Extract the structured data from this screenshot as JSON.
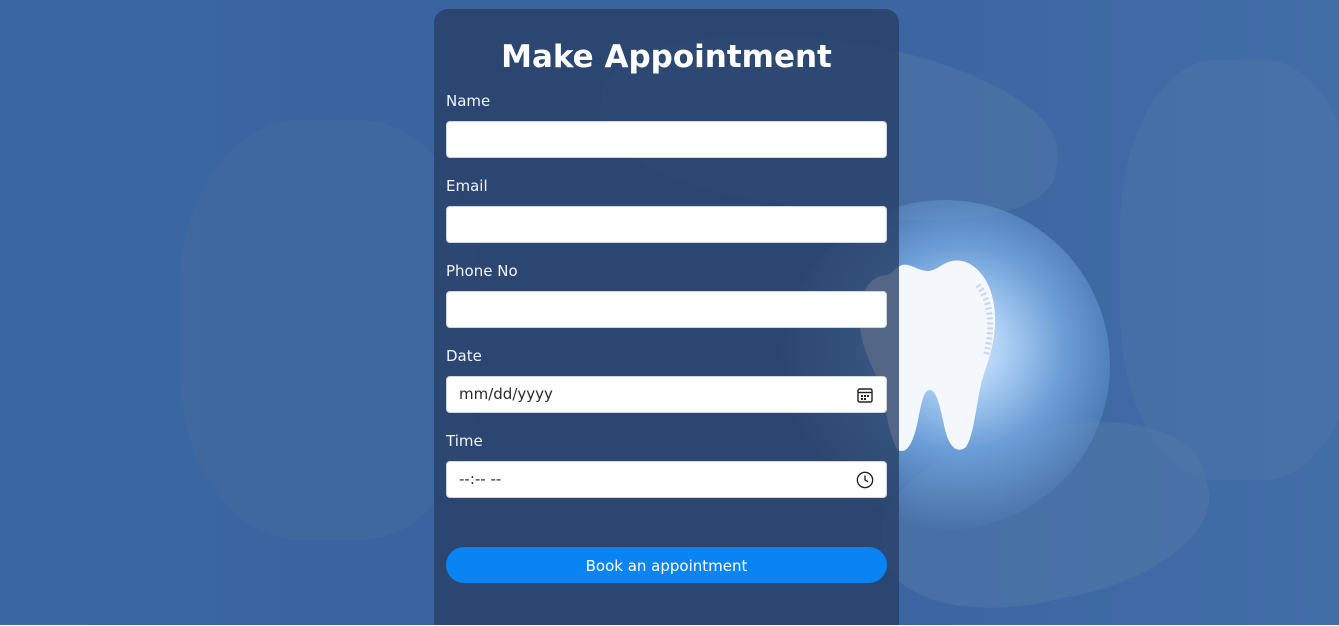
{
  "form": {
    "title": "Make Appointment",
    "fields": [
      {
        "label": "Name",
        "value": ""
      },
      {
        "label": "Email",
        "value": ""
      },
      {
        "label": "Phone No",
        "value": ""
      },
      {
        "label": "Date",
        "value": "mm/dd/yyyy",
        "icon": "calendar-icon"
      },
      {
        "label": "Time",
        "value": "--:-- --",
        "icon": "clock-icon"
      }
    ],
    "submit_label": "Book an appointment"
  },
  "colors": {
    "background": "#3a64a0",
    "card": "#263e64",
    "button": "#0a84f2"
  },
  "background_image": "tooth-held-in-hands"
}
